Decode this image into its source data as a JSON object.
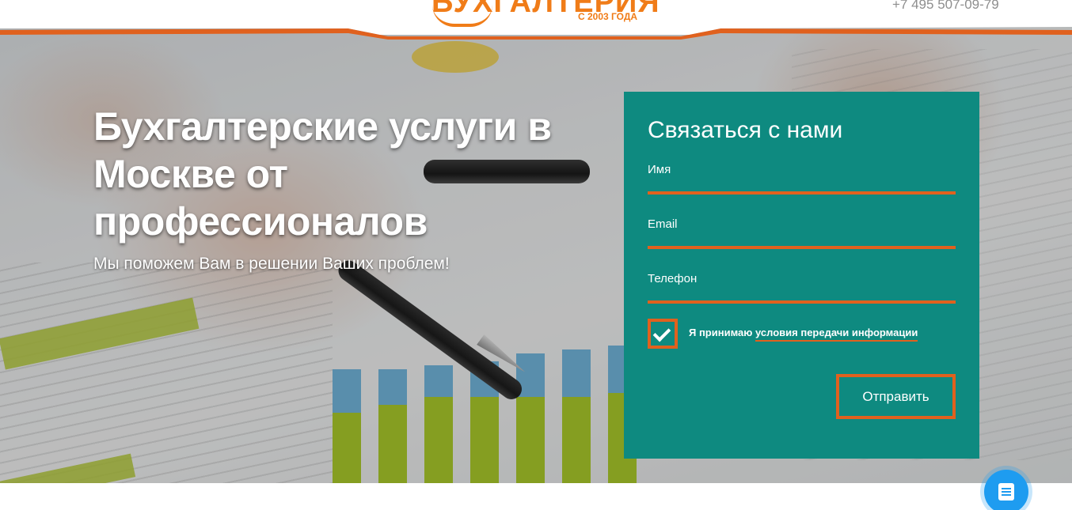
{
  "header": {
    "logo_text": "БУХГАЛТЕРИЯ",
    "logo_since": "С 2003 ГОДА",
    "phone": "+7 495 507-09-79"
  },
  "hero": {
    "title": "Бухгалтерские услуги в Москве от профессионалов",
    "subtitle": "Мы поможем Вам в решении Ваших проблем!"
  },
  "contact_form": {
    "title": "Связаться с нами",
    "fields": [
      {
        "label": "Имя",
        "value": ""
      },
      {
        "label": "Email",
        "value": ""
      },
      {
        "label": "Телефон",
        "value": ""
      }
    ],
    "consent_text": "Я принимаю",
    "consent_link": "условия передачи информации",
    "consent_checked": true,
    "submit_label": "Отправить"
  },
  "colors": {
    "accent": "#e0611e",
    "form_bg": "#0e8a80",
    "chat_button": "#1e9cf0"
  },
  "icons": {
    "checkbox": "check-icon",
    "chat": "chat-icon"
  }
}
